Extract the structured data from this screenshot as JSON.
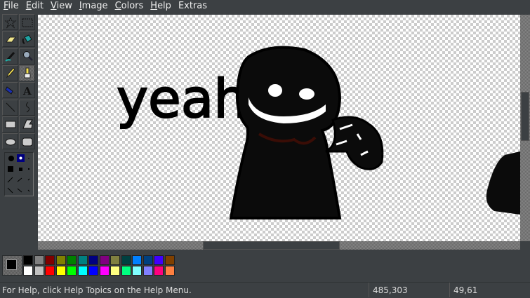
{
  "menu": [
    "File",
    "Edit",
    "View",
    "Image",
    "Colors",
    "Help",
    "Extras"
  ],
  "menu_access": [
    "F",
    "E",
    "V",
    "I",
    "C",
    "H",
    "x"
  ],
  "tools": [
    {
      "name": "free-form-select",
      "icon": "star-select-icon"
    },
    {
      "name": "select",
      "icon": "rect-select-icon"
    },
    {
      "name": "eraser",
      "icon": "eraser-icon"
    },
    {
      "name": "fill-with-color",
      "icon": "paint-bucket-icon"
    },
    {
      "name": "pick-color",
      "icon": "eyedropper-icon"
    },
    {
      "name": "magnifier",
      "icon": "magnifier-icon"
    },
    {
      "name": "pencil",
      "icon": "pencil-icon"
    },
    {
      "name": "brush",
      "icon": "brush-icon",
      "selected": true
    },
    {
      "name": "airbrush",
      "icon": "airbrush-icon"
    },
    {
      "name": "text",
      "icon": "text-icon",
      "glyph": "A"
    },
    {
      "name": "line",
      "icon": "line-icon"
    },
    {
      "name": "curve",
      "icon": "curve-icon"
    },
    {
      "name": "rectangle",
      "icon": "rectangle-icon"
    },
    {
      "name": "polygon",
      "icon": "polygon-icon"
    },
    {
      "name": "ellipse",
      "icon": "ellipse-icon"
    },
    {
      "name": "rounded-rectangle",
      "icon": "rounded-rectangle-icon"
    }
  ],
  "canvas": {
    "drawing_text": "yeah"
  },
  "colors": {
    "foreground": "#000000",
    "background": "#ffffff"
  },
  "palette": [
    "#000000",
    "#808080",
    "#800000",
    "#808000",
    "#008000",
    "#008080",
    "#000080",
    "#800080",
    "#808040",
    "#004040",
    "#0080ff",
    "#004080",
    "#4000ff",
    "#804000",
    "#ffffff",
    "#c0c0c0",
    "#ff0000",
    "#ffff00",
    "#00ff00",
    "#00ffff",
    "#0000ff",
    "#ff00ff",
    "#ffff80",
    "#00ff80",
    "#80ffff",
    "#8080ff",
    "#ff0080",
    "#ff8040"
  ],
  "status": {
    "help": "For Help, click Help Topics on the Help Menu.",
    "position": "485,303",
    "size": "49,61"
  }
}
